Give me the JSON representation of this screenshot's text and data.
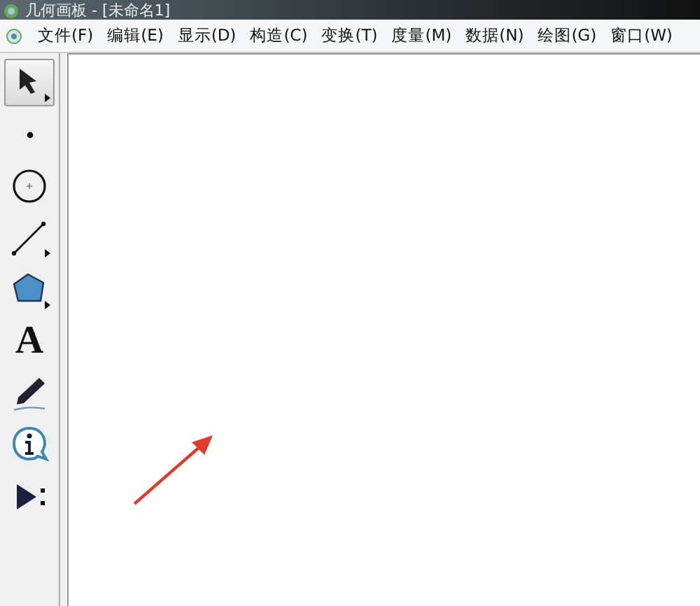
{
  "window": {
    "title": "几何画板 - [未命名1]"
  },
  "menu": [
    "文件(F)",
    "编辑(E)",
    "显示(D)",
    "构造(C)",
    "变换(T)",
    "度量(M)",
    "数据(N)",
    "绘图(G)",
    "窗口(W)"
  ],
  "tools": [
    {
      "kind": "arrow",
      "selected": true,
      "submenu": true
    },
    {
      "kind": "point",
      "selected": false,
      "submenu": false
    },
    {
      "kind": "compass",
      "selected": false,
      "submenu": false
    },
    {
      "kind": "line",
      "selected": false,
      "submenu": true
    },
    {
      "kind": "polygon",
      "selected": false,
      "submenu": true
    },
    {
      "kind": "text",
      "selected": false,
      "submenu": false,
      "glyph": "A"
    },
    {
      "kind": "marker",
      "selected": false,
      "submenu": false
    },
    {
      "kind": "info",
      "selected": false,
      "submenu": false
    },
    {
      "kind": "custom",
      "selected": false,
      "submenu": false
    }
  ]
}
